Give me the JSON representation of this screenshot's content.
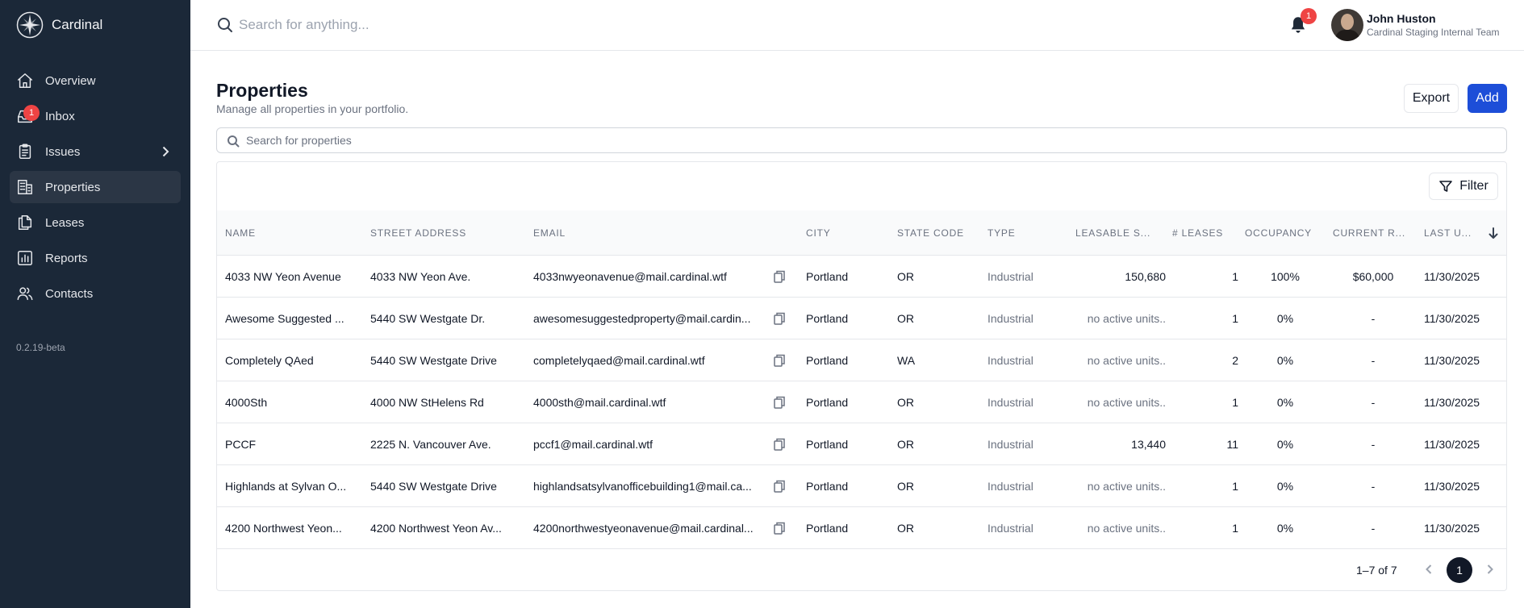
{
  "app": {
    "name": "Cardinal",
    "version": "0.2.19-beta"
  },
  "sidebar": {
    "items": [
      {
        "label": "Overview"
      },
      {
        "label": "Inbox",
        "badge": "1"
      },
      {
        "label": "Issues"
      },
      {
        "label": "Properties"
      },
      {
        "label": "Leases"
      },
      {
        "label": "Reports"
      },
      {
        "label": "Contacts"
      }
    ]
  },
  "topbar": {
    "search_placeholder": "Search for anything...",
    "notification_count": "1",
    "user_name": "John Huston",
    "user_team": "Cardinal Staging Internal Team"
  },
  "main": {
    "title": "Properties",
    "subtitle": "Manage all properties in your portfolio.",
    "export_label": "Export",
    "add_label": "Add",
    "search_placeholder": "Search for properties",
    "filter_label": "Filter"
  },
  "table": {
    "columns": [
      "NAME",
      "STREET ADDRESS",
      "EMAIL",
      "CITY",
      "STATE CODE",
      "TYPE",
      "LEASABLE S...",
      "# LEASES",
      "OCCUPANCY",
      "CURRENT R...",
      "LAST U..."
    ],
    "rows": [
      {
        "name": "4033 NW Yeon Avenue",
        "address": "4033 NW Yeon Ave.",
        "email": "4033nwyeonavenue@mail.cardinal.wtf",
        "city": "Portland",
        "state": "OR",
        "type": "Industrial",
        "leasable": "150,680",
        "leases": "1",
        "occupancy": "100%",
        "rent": "$60,000",
        "updated": "11/30/2025"
      },
      {
        "name": "Awesome Suggested ...",
        "address": "5440 SW Westgate Dr.",
        "email": "awesomesuggestedproperty@mail.cardin...",
        "city": "Portland",
        "state": "OR",
        "type": "Industrial",
        "leasable": "no active units..",
        "leases": "1",
        "occupancy": "0%",
        "rent": "-",
        "updated": "11/30/2025"
      },
      {
        "name": "Completely QAed",
        "address": "5440 SW Westgate Drive",
        "email": "completelyqaed@mail.cardinal.wtf",
        "city": "Portland",
        "state": "WA",
        "type": "Industrial",
        "leasable": "no active units..",
        "leases": "2",
        "occupancy": "0%",
        "rent": "-",
        "updated": "11/30/2025"
      },
      {
        "name": "4000Sth",
        "address": "4000 NW StHelens Rd",
        "email": "4000sth@mail.cardinal.wtf",
        "city": "Portland",
        "state": "OR",
        "type": "Industrial",
        "leasable": "no active units..",
        "leases": "1",
        "occupancy": "0%",
        "rent": "-",
        "updated": "11/30/2025"
      },
      {
        "name": "PCCF",
        "address": "2225 N. Vancouver Ave.",
        "email": "pccf1@mail.cardinal.wtf",
        "city": "Portland",
        "state": "OR",
        "type": "Industrial",
        "leasable": "13,440",
        "leases": "11",
        "occupancy": "0%",
        "rent": "-",
        "updated": "11/30/2025"
      },
      {
        "name": "Highlands at Sylvan O...",
        "address": "5440 SW Westgate Drive",
        "email": "highlandsatsylvanofficebuilding1@mail.ca...",
        "city": "Portland",
        "state": "OR",
        "type": "Industrial",
        "leasable": "no active units..",
        "leases": "1",
        "occupancy": "0%",
        "rent": "-",
        "updated": "11/30/2025"
      },
      {
        "name": "4200 Northwest Yeon...",
        "address": "4200 Northwest Yeon Av...",
        "email": "4200northwestyeonavenue@mail.cardinal...",
        "city": "Portland",
        "state": "OR",
        "type": "Industrial",
        "leasable": "no active units..",
        "leases": "1",
        "occupancy": "0%",
        "rent": "-",
        "updated": "11/30/2025"
      }
    ]
  },
  "pagination": {
    "range": "1–7 of 7",
    "current_page": "1"
  },
  "icons": {
    "brand": "compass-star-icon",
    "overview": "home-icon",
    "inbox": "inbox-icon",
    "issues": "clipboard-icon",
    "properties": "building-icon",
    "leases": "documents-icon",
    "reports": "bar-chart-icon",
    "contacts": "users-icon",
    "notifications": "bell-icon",
    "copy": "copy-icon",
    "filter": "funnel-icon",
    "sort": "arrow-down-icon"
  },
  "colors": {
    "sidebar_bg": "#1b2838",
    "primary": "#1d4ed8",
    "badge": "#ef4444"
  }
}
